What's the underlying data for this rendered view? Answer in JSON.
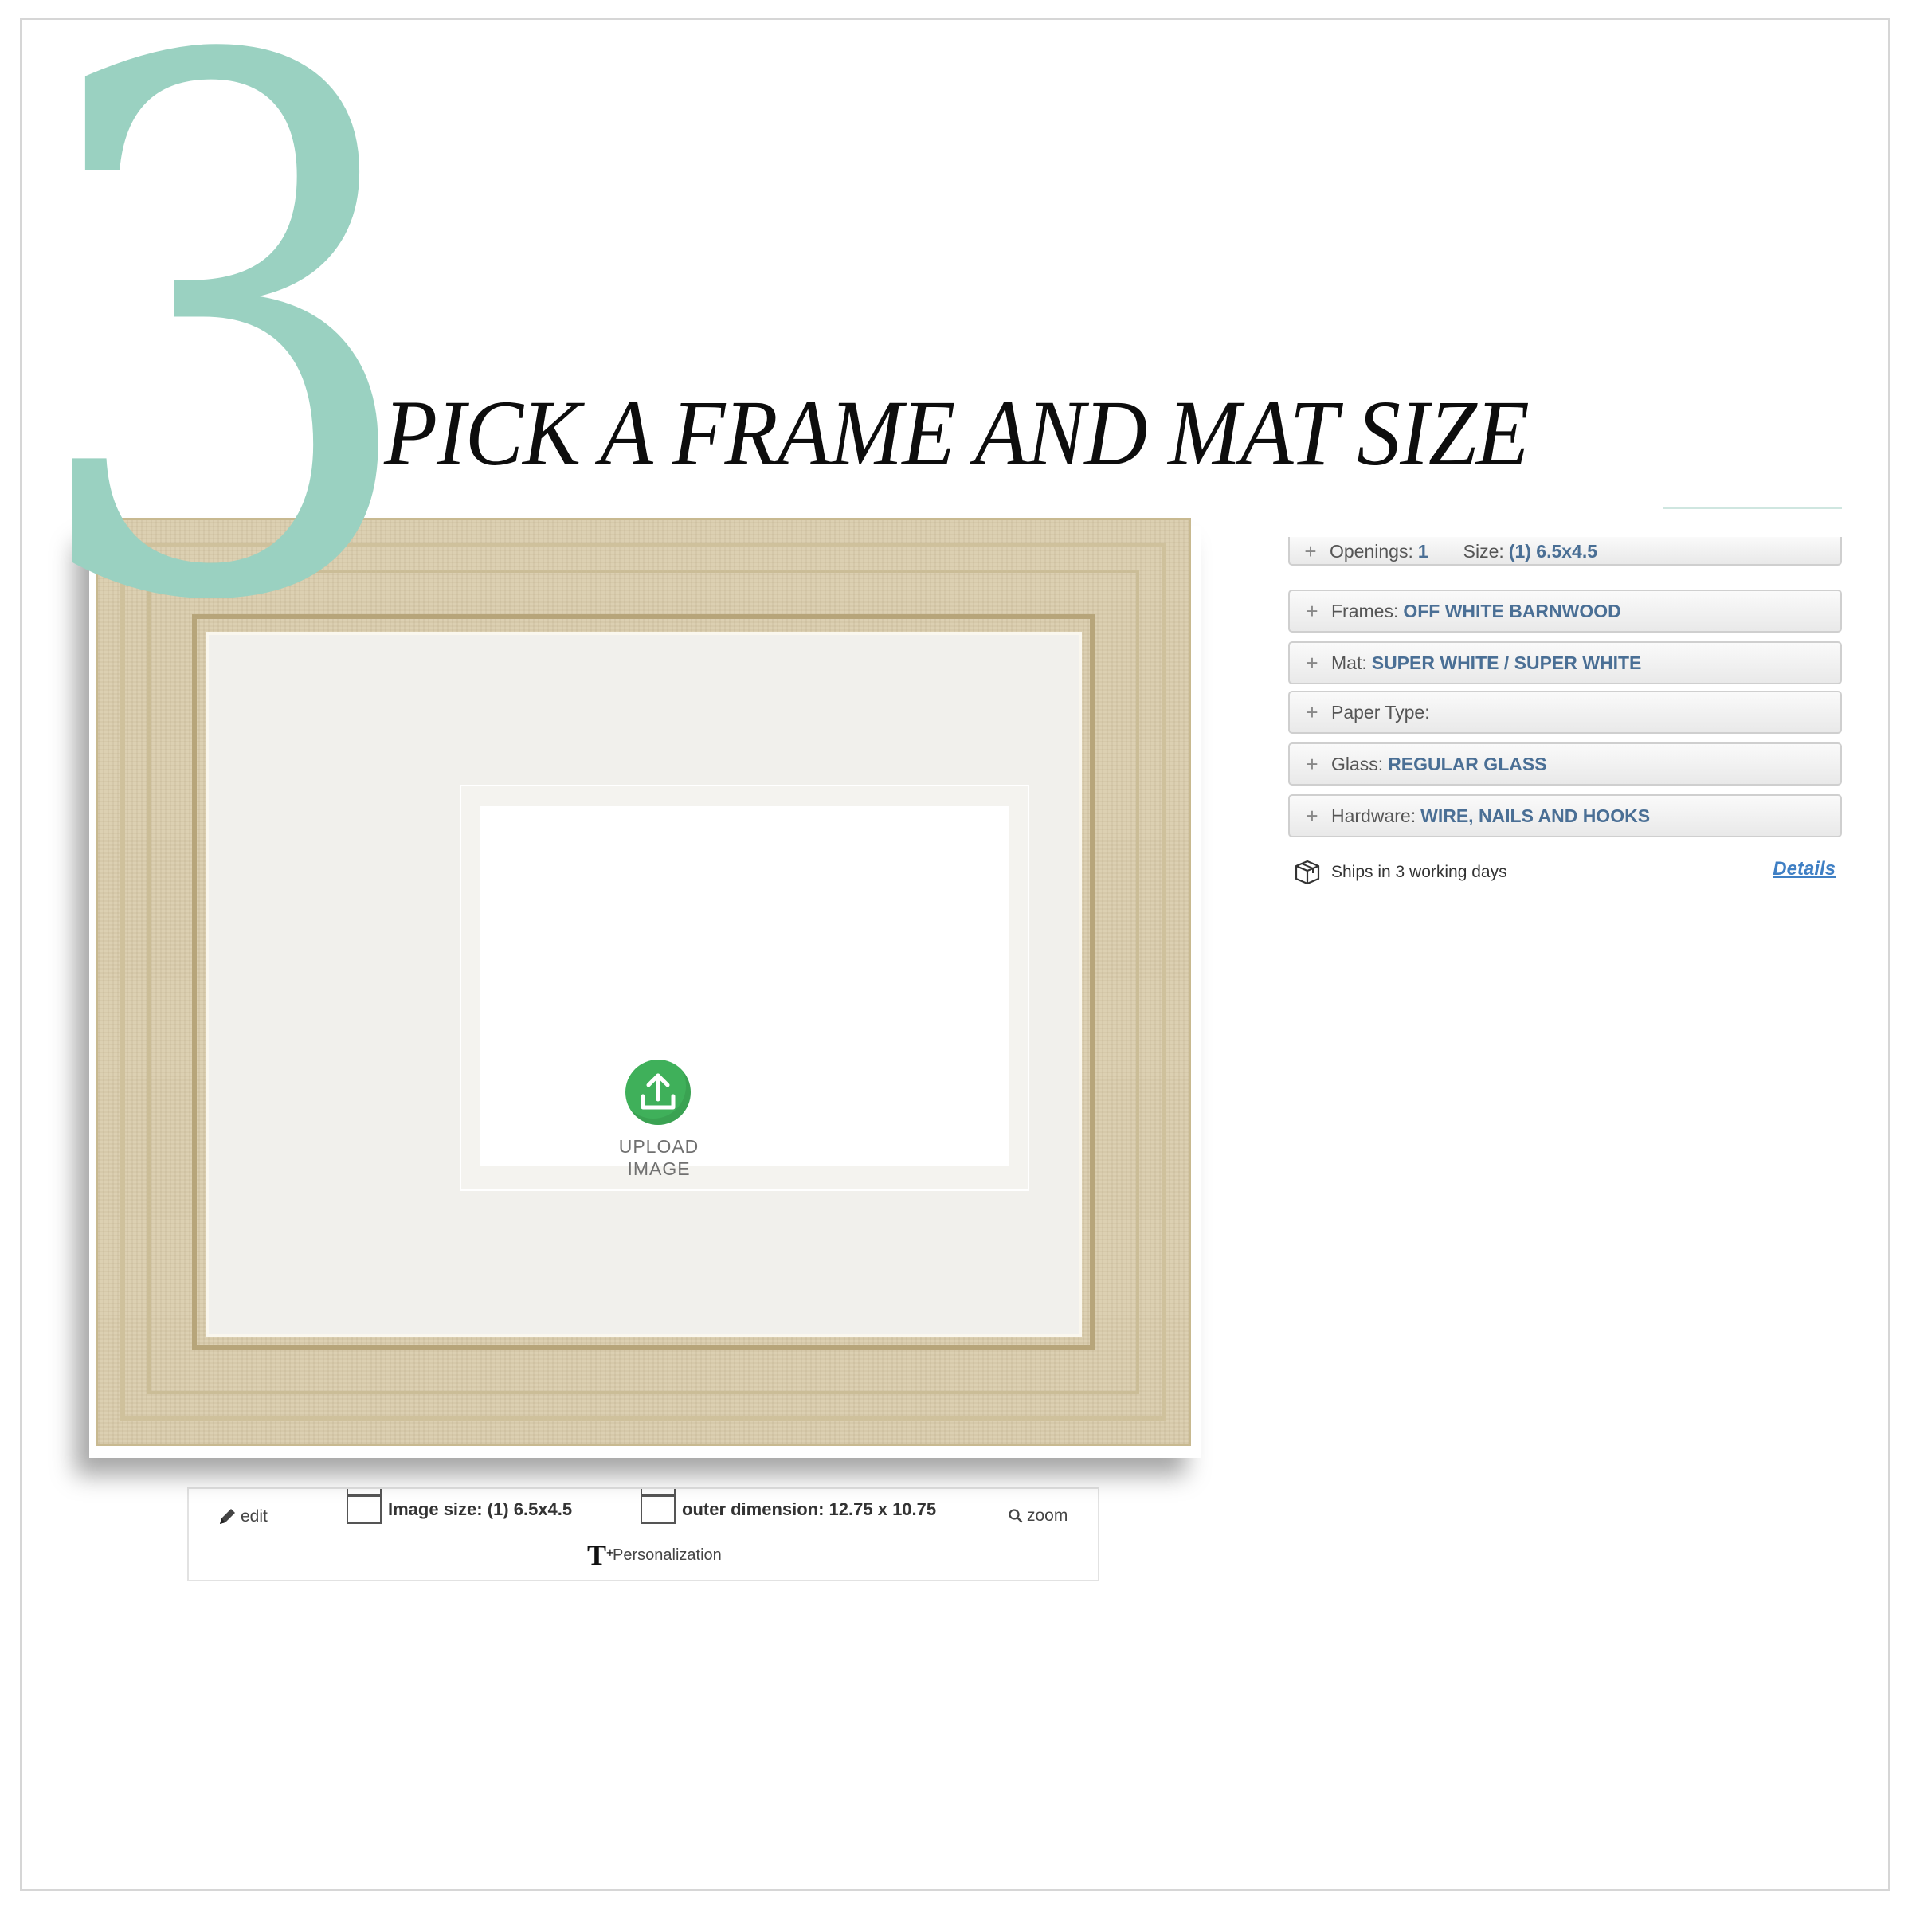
{
  "step": {
    "number": "3",
    "heading": "PICK A FRAME AND MAT SIZE"
  },
  "preview": {
    "upload_label_line1": "UPLOAD",
    "upload_label_line2": "IMAGE",
    "upload_icon": "upload-icon"
  },
  "toolbar": {
    "edit_label": "edit",
    "image_size_label": "Image size: (1) 6.5x4.5",
    "outer_dimension_label": "outer dimension: 12.75 x 10.75",
    "zoom_label": "zoom",
    "personalization_label": "Personalization"
  },
  "options": {
    "rows": [
      {
        "label": "Openings:",
        "value": "1",
        "label2": "Size:",
        "value2": "(1) 6.5x4.5"
      },
      {
        "label": "Frames:",
        "value": "OFF WHITE BARNWOOD"
      },
      {
        "label": "Mat:",
        "value": "SUPER WHITE / SUPER WHITE"
      },
      {
        "label": "Paper Type:",
        "value": ""
      },
      {
        "label": "Glass:",
        "value": "REGULAR GLASS"
      },
      {
        "label": "Hardware:",
        "value": "WIRE, NAILS AND HOOKS"
      }
    ],
    "expand_symbol": "+",
    "ships_text": "Ships in 3 working days",
    "details_link": "Details"
  },
  "colors": {
    "accent_number": "#9ad1c1",
    "option_value": "#4a6f95",
    "upload_green": "#3fb05a",
    "details_link": "#3f7fc4",
    "frame_wood": "#dcd0b2",
    "mat": "#f1f0ec"
  }
}
